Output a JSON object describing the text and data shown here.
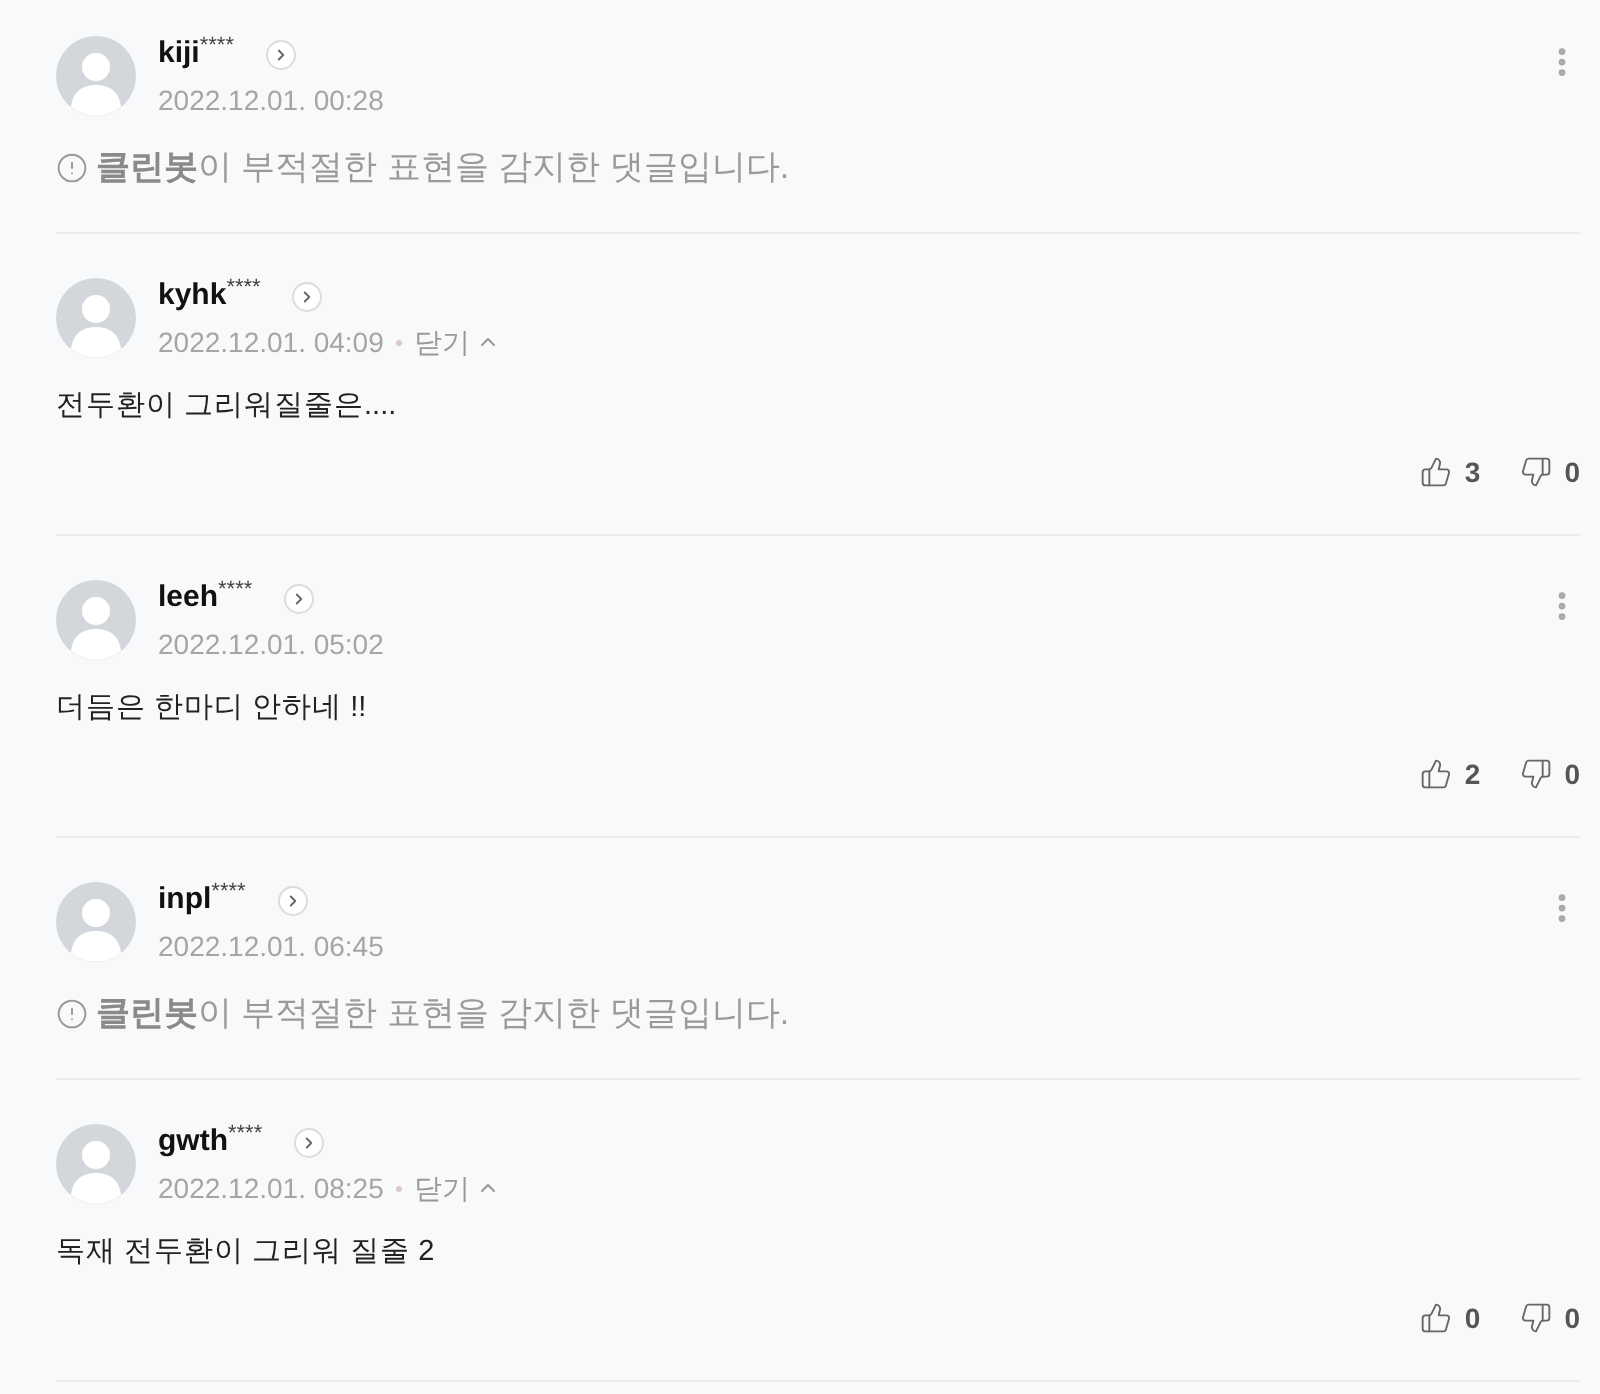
{
  "comments": [
    {
      "kind": "blocked",
      "author": "kiji$^{****}$",
      "date": "2022.12.01. 00:28",
      "text": "**클린봇**이 부적절한 표현을 감지한 댓글입니다.",
      "menu": true
    },
    {
      "kind": "text",
      "author": "kyhk$^{****}$",
      "date": "2022.12.01. 04:09",
      "toggle": {
        "label": "닫기",
        "expanded": true
      },
      "text": "전두환이 그리워질줄은....",
      "menu": false,
      "likes": "3",
      "dislikes": "0"
    },
    {
      "kind": "text",
      "author": "leeh$^{****}$",
      "date": "2022.12.01. 05:02",
      "text": "더듬은 한마디 안하네 !!",
      "menu": true,
      "likes": "2",
      "dislikes": "0"
    },
    {
      "kind": "blocked",
      "author": "inpl$^{****}$",
      "date": "2022.12.01. 06:45",
      "text": "**클린봇**이 부적절한 표현을 감지한 댓글입니다.",
      "menu": true
    },
    {
      "kind": "text",
      "author": "gwth$^{****}$",
      "date": "2022.12.01. 08:25",
      "toggle": {
        "label": "닫기",
        "expanded": true
      },
      "text": "독재 전두환이 그리워 질줄 2",
      "menu": false,
      "likes": "0",
      "dislikes": "0"
    }
  ]
}
